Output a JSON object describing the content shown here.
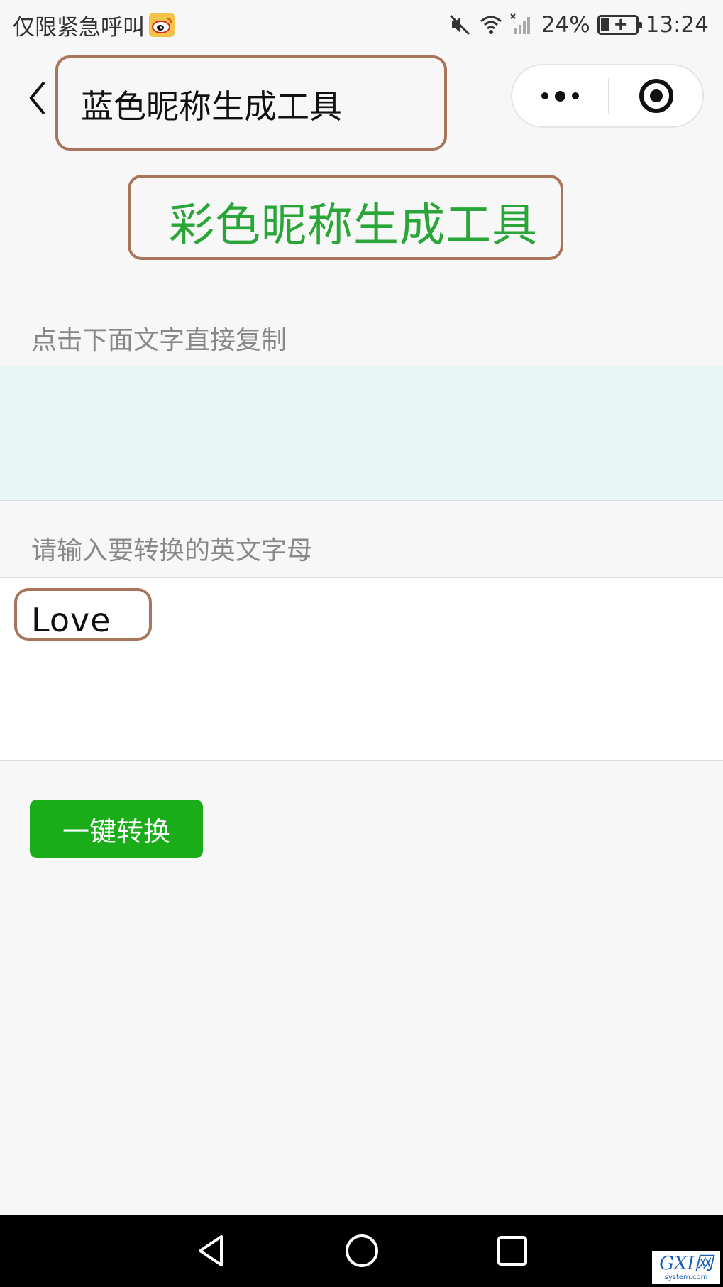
{
  "status_bar": {
    "carrier": "仅限紧急呼叫",
    "battery": "24%",
    "time": "13:24",
    "icons": [
      "weibo-icon",
      "mute-icon",
      "wifi-icon",
      "signal-icon",
      "battery-icon"
    ]
  },
  "nav": {
    "title": "蓝色昵称生成工具",
    "icons": [
      "back-icon",
      "more-icon",
      "close-icon"
    ]
  },
  "heading": "彩色昵称生成工具",
  "output": {
    "hint": "点击下面文字直接复制",
    "value": ""
  },
  "input": {
    "hint": "请输入要转换的英文字母",
    "value": "Love"
  },
  "convert_button": "一键转换",
  "system_nav": [
    "back-triangle-icon",
    "home-circle-icon",
    "recents-square-icon"
  ],
  "watermark": {
    "main": "GXI网",
    "sub": "system.com"
  },
  "colors": {
    "heading": "#2aa639",
    "button": "#1aad19",
    "output_bg": "#e8f7f6",
    "annotation": "#a9755a"
  }
}
